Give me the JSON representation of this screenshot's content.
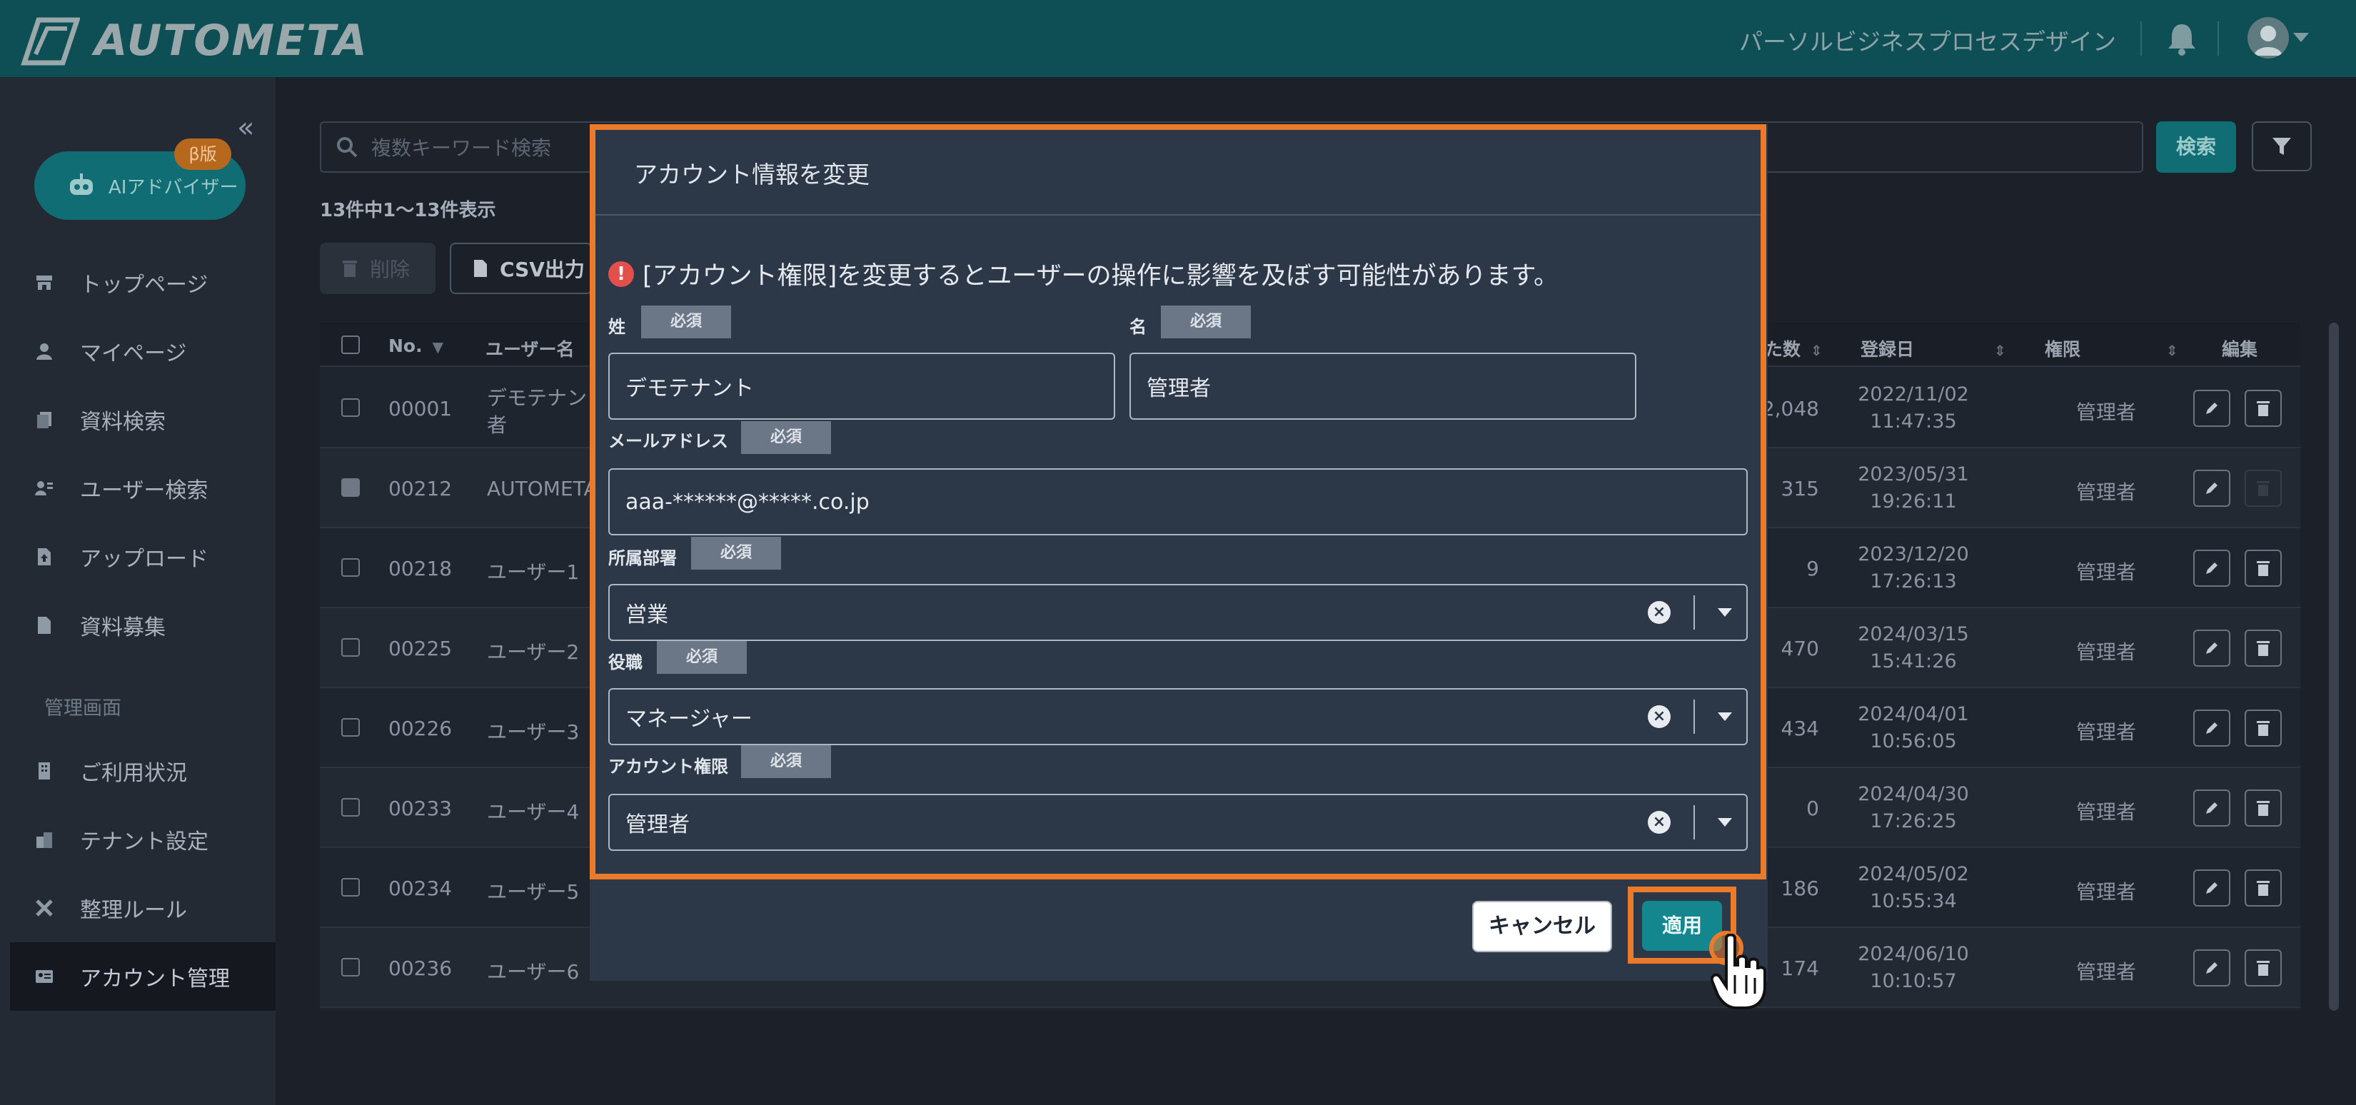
{
  "header": {
    "logo_text": "AUTOMETA",
    "company": "パーソルビジネスプロセスデザイン"
  },
  "sidebar": {
    "ai_button": "AIアドバイザー",
    "beta_badge": "β版",
    "items": [
      {
        "label": "トップページ",
        "icon": "store-icon"
      },
      {
        "label": "マイページ",
        "icon": "person-icon"
      },
      {
        "label": "資料検索",
        "icon": "documents-icon"
      },
      {
        "label": "ユーザー検索",
        "icon": "user-search-icon"
      },
      {
        "label": "アップロード",
        "icon": "upload-file-icon"
      },
      {
        "label": "資料募集",
        "icon": "file-icon"
      }
    ],
    "section_label": "管理画面",
    "admin_items": [
      {
        "label": "ご利用状況",
        "icon": "building-icon"
      },
      {
        "label": "テナント設定",
        "icon": "tenant-icon"
      },
      {
        "label": "整理ルール",
        "icon": "tools-icon"
      },
      {
        "label": "アカウント管理",
        "icon": "id-card-icon"
      }
    ]
  },
  "main": {
    "search_placeholder": "複数キーワード検索",
    "search_button": "検索",
    "result_count": "13件中1〜13件表示",
    "delete_button": "削除",
    "csv_button": "CSV出力",
    "columns": {
      "no": "No.",
      "username": "ユーザー名",
      "count": "た数",
      "registered": "登録日",
      "role": "権限",
      "edit": "編集"
    },
    "rows": [
      {
        "no": "00001",
        "name": "デモテナン",
        "name2": "者",
        "count": "2,048",
        "date": "2022/11/02",
        "time": "11:47:35",
        "role": "管理者",
        "checked": false
      },
      {
        "no": "00212",
        "name": "AUTOMETA",
        "name2": "",
        "count": "315",
        "date": "2023/05/31",
        "time": "19:26:11",
        "role": "管理者",
        "checked": true
      },
      {
        "no": "00218",
        "name": "ユーザー1",
        "name2": "",
        "count": "9",
        "date": "2023/12/20",
        "time": "17:26:13",
        "role": "管理者",
        "checked": false
      },
      {
        "no": "00225",
        "name": "ユーザー2",
        "name2": "",
        "count": "470",
        "date": "2024/03/15",
        "time": "15:41:26",
        "role": "管理者",
        "checked": false
      },
      {
        "no": "00226",
        "name": "ユーザー3",
        "name2": "",
        "count": "434",
        "date": "2024/04/01",
        "time": "10:56:05",
        "role": "管理者",
        "checked": false
      },
      {
        "no": "00233",
        "name": "ユーザー4",
        "name2": "",
        "count": "0",
        "date": "2024/04/30",
        "time": "17:26:25",
        "role": "管理者",
        "checked": false
      },
      {
        "no": "00234",
        "name": "ユーザー5",
        "name2": "",
        "count": "186",
        "date": "2024/05/02",
        "time": "10:55:34",
        "role": "管理者",
        "checked": false
      },
      {
        "no": "00236",
        "name": "ユーザー6",
        "name2": "",
        "count": "174",
        "date": "2024/06/10",
        "time": "10:10:57",
        "role": "管理者",
        "checked": false
      }
    ]
  },
  "modal": {
    "title": "アカウント情報を変更",
    "warning": "[アカウント権限]を変更するとユーザーの操作に影響を及ぼす可能性があります。",
    "required": "必須",
    "last_name_label": "姓",
    "last_name_value": "デモテナント",
    "first_name_label": "名",
    "first_name_value": "管理者",
    "email_label": "メールアドレス",
    "email_value": "aaa-******@*****.co.jp",
    "department_label": "所属部署",
    "department_value": "営業",
    "position_label": "役職",
    "position_value": "マネージャー",
    "permission_label": "アカウント権限",
    "permission_value": "管理者",
    "cancel_button": "キャンセル",
    "apply_button": "適用"
  },
  "colors": {
    "header_bg": "#0e4f55",
    "accent_teal": "#14878e",
    "highlight_orange": "#ec7a2b",
    "warning_red": "#e2504b",
    "modal_bg": "#2c3747"
  }
}
